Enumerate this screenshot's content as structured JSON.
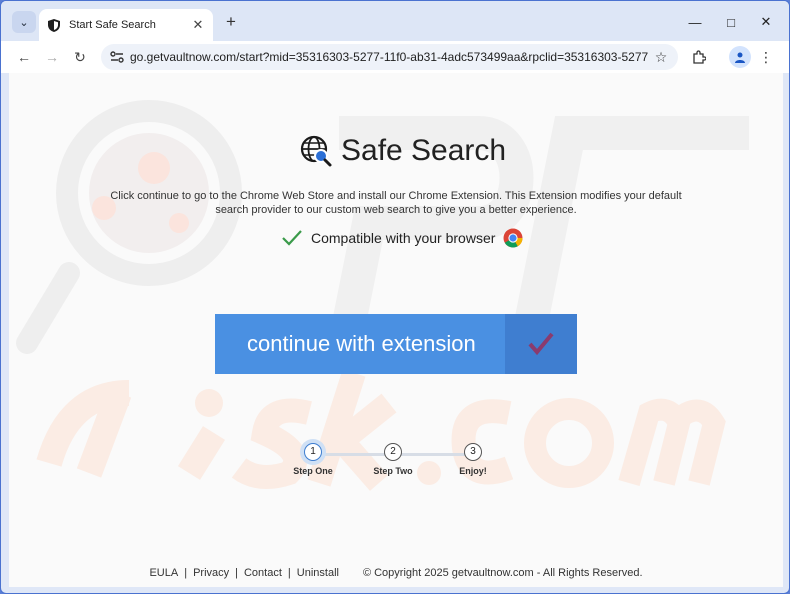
{
  "browser": {
    "tab_title": "Start Safe Search",
    "url": "go.getvaultnow.com/start?mid=35316303-5277-11f0-ab31-4adc573499aa&rpclid=35316303-5277-11f0-ab31..."
  },
  "page": {
    "brand": "Safe Search",
    "description": "Click continue to go to the Chrome Web Store and install our Chrome Extension. This Extension modifies your default search provider to our custom web search to give you a better experience.",
    "compat_text": "Compatible with your browser",
    "cta_label": "continue with extension",
    "steps": [
      {
        "num": "1",
        "label": "Step One"
      },
      {
        "num": "2",
        "label": "Step Two"
      },
      {
        "num": "3",
        "label": "Enjoy!"
      }
    ],
    "footer": {
      "links": [
        "EULA",
        "Privacy",
        "Contact",
        "Uninstall"
      ],
      "copyright": "© Copyright 2025 getvaultnow.com - All Rights Reserved."
    }
  },
  "colors": {
    "accent": "#4a90e2",
    "accent_dark": "#3f7ed0",
    "check": "#3a9a4a"
  }
}
